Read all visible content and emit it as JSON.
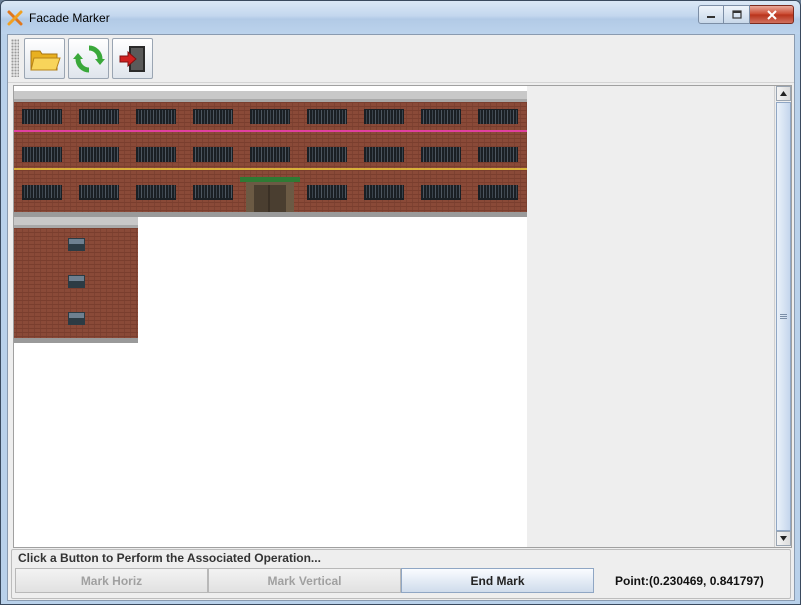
{
  "window": {
    "title": "Facade Marker",
    "app_icon": "x-cross-icon",
    "controls": [
      "minimize-icon",
      "maximize-icon",
      "close-icon"
    ]
  },
  "toolbar": {
    "buttons": [
      {
        "name": "open",
        "icon": "folder-open-icon"
      },
      {
        "name": "refresh",
        "icon": "refresh-icon"
      },
      {
        "name": "exit",
        "icon": "exit-door-icon"
      }
    ]
  },
  "canvas": {
    "images": [
      {
        "name": "facade-large",
        "window_rows": 3,
        "window_cols": 9,
        "marked_lines": [
          "magenta",
          "yellow"
        ]
      },
      {
        "name": "facade-small",
        "window_rows": 3,
        "window_cols": 1
      }
    ],
    "colors": {
      "brick": "#8a4a38",
      "mark_magenta": "#e040a0",
      "mark_yellow": "#f2d23a"
    }
  },
  "panel": {
    "caption": "Click a Button to Perform the Associated Operation...",
    "buttons": [
      {
        "label": "Mark Horiz",
        "enabled": false
      },
      {
        "label": "Mark Vertical",
        "enabled": false
      },
      {
        "label": "End Mark",
        "enabled": true
      }
    ],
    "point": "Point:(0.230469, 0.841797)"
  }
}
